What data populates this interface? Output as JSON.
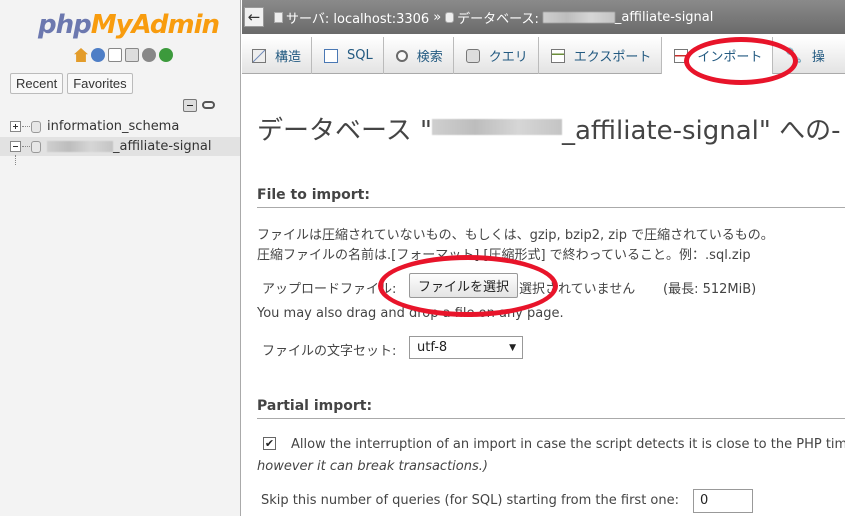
{
  "sidebar": {
    "logo_php": "php",
    "logo_admin": "MyAdmin",
    "tabs": [
      "Recent",
      "Favorites"
    ],
    "tree": [
      {
        "label": "information_schema"
      },
      {
        "label_suffix": "_affiliate-signal"
      }
    ]
  },
  "breadcrumb": {
    "back": "←",
    "server": "サーバ: localhost:3306",
    "sep": "»",
    "database_prefix": "データベース:",
    "database_suffix": "_affiliate-signal"
  },
  "tabs": [
    {
      "label": "構造",
      "icon": "structure-icon"
    },
    {
      "label": "SQL",
      "icon": "sql-icon"
    },
    {
      "label": "検索",
      "icon": "search-icon"
    },
    {
      "label": "クエリ",
      "icon": "query-icon"
    },
    {
      "label": "エクスポート",
      "icon": "export-icon"
    },
    {
      "label": "インポート",
      "icon": "import-icon"
    },
    {
      "label": "操",
      "icon": "wrench-icon"
    }
  ],
  "content": {
    "heading_prefix": "データベース \"",
    "heading_suffix": "_affiliate-signal\" への-",
    "file_section": {
      "legend": "File to import:",
      "line1": "ファイルは圧縮されていないもの、もしくは、gzip, bzip2, zip で圧縮されているもの。",
      "line2": "圧縮ファイルの名前は.[フォーマット].[圧縮形式] で終わっていること。例：.sql.zip",
      "upload_label": "アップロードファイル:",
      "file_button": "ファイルを選択",
      "no_file": "選択されていません",
      "max_size": "(最長: 512MiB)",
      "drag_note": "You may also drag and drop a file on any page.",
      "charset_label": "ファイルの文字セット:",
      "charset_value": "utf-8"
    },
    "partial_section": {
      "legend": "Partial import:",
      "checkbox_checked": true,
      "interrupt_text": "Allow the interruption of an import in case the script detects it is close to the PHP time",
      "interrupt_note": "however it can break transactions.)",
      "skip_label": "Skip this number of queries (for SQL) starting from the first one:",
      "skip_value": "0"
    }
  },
  "colors": {
    "annotation_red": "#e8142a",
    "link_blue": "#235a81"
  }
}
